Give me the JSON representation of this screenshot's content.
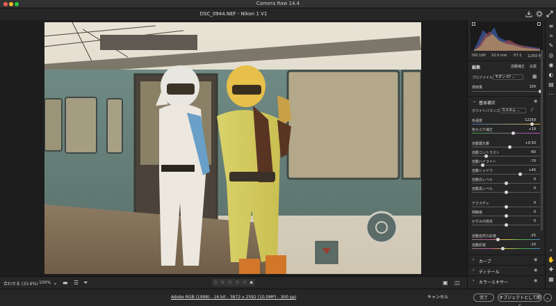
{
  "app_title": "Camera Raw 14.4",
  "document_title": "DSC_0944.NEF  -  Nikon 1 V1",
  "colors": {
    "background": "#1d1d1d",
    "panel": "#262626",
    "accent_blue": "#4a7fd0",
    "temp_gradient": [
      "#4a6fb3",
      "#e0c64a"
    ],
    "tint_gradient": [
      "#3fa14a",
      "#c64ac6"
    ]
  },
  "icons": {
    "titlebar": [
      "save-icon",
      "gear-icon",
      "fullscreen-icon"
    ],
    "tools": [
      "edit-sliders-icon",
      "crop-icon",
      "healing-brush-icon",
      "mask-icon",
      "red-eye-icon",
      "presets-icon",
      "snapshots-icon",
      "more-icon",
      "zoom-icon",
      "hand-icon",
      "color-sampler-icon",
      "grid-icon"
    ]
  },
  "bottom_toolbar": {
    "zoom_label": "合わせる (33.6%)",
    "zoom_value": "100%",
    "rating_stars": "☆ ☆ ☆ ☆ ☆",
    "flag_count": ""
  },
  "footer": {
    "file_info": "Adobe RGB (1998) - 16 bit - 3872 x 2592 (10.0MP) - 300 ppi",
    "cancel": "キャンセル",
    "done": "完了",
    "open": "オブジェクトとして開く"
  },
  "histogram": {
    "exif": {
      "iso": "ISO 100",
      "focal": "10.0 mm",
      "aperture": "f/7.1",
      "shutter": "1/250 秒"
    }
  },
  "panel": {
    "edit_title": "編集",
    "auto_label": "自動補正",
    "bw_label": "白黒",
    "profile_label": "プロファイル",
    "profile_value": "モダン 07",
    "amount_label": "適用量",
    "amount_value": "100",
    "amount_level": 1.0,
    "basic_title": "基本補正",
    "wb_label": "ホワイトバランス",
    "wb_value": "カスタム",
    "sliders": [
      {
        "label": "色温度",
        "value": "12250",
        "level": 0.88,
        "kind": "temp"
      },
      {
        "label": "色かぶり補正",
        "value": "+19",
        "level": 0.6,
        "kind": "tint"
      },
      {
        "label": "自動露光量",
        "value": "+0.50",
        "level": 0.55,
        "kind": "plain"
      },
      {
        "label": "自動コントラスト",
        "value": "-60",
        "level": 0.2,
        "kind": "plain"
      },
      {
        "label": "自動ハイライト",
        "value": "-70",
        "level": 0.15,
        "kind": "plain"
      },
      {
        "label": "自動シャドウ",
        "value": "+40",
        "level": 0.7,
        "kind": "plain"
      },
      {
        "label": "自動白レベル",
        "value": "0",
        "level": 0.5,
        "kind": "plain"
      },
      {
        "label": "自動黒レベル",
        "value": "0",
        "level": 0.5,
        "kind": "plain"
      },
      {
        "label": "テクスチャ",
        "value": "0",
        "level": 0.5,
        "kind": "plain"
      },
      {
        "label": "明瞭度",
        "value": "0",
        "level": 0.5,
        "kind": "plain"
      },
      {
        "label": "かすみの除去",
        "value": "0",
        "level": 0.5,
        "kind": "plain"
      },
      {
        "label": "自動自然な彩度",
        "value": "-25",
        "level": 0.375,
        "kind": "vib"
      },
      {
        "label": "自動彩度",
        "value": "-10",
        "level": 0.45,
        "kind": "vib"
      }
    ],
    "collapsed_sections": [
      "カーブ",
      "ディテール",
      "カラーミキサー"
    ]
  }
}
